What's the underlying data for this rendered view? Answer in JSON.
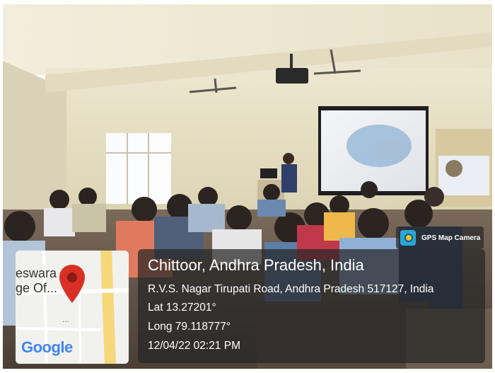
{
  "gps_badge": {
    "label": "GPS Map Camera",
    "icon": "camera-icon"
  },
  "location": {
    "title": "Chittoor, Andhra Pradesh, India",
    "address": "R.V.S. Nagar Tirupati Road, Andhra Pradesh 517127, India",
    "latitude": "Lat 13.27201°",
    "longitude": "Long 79.118777°",
    "datetime": "12/04/22 02:21 PM"
  },
  "map": {
    "label_line_1": "eswara",
    "label_line_2": "ge Of...",
    "dots": "...",
    "provider": "Google",
    "pin_icon": "map-pin-icon",
    "pin_color": "#d93025"
  },
  "photo": {
    "description_colors": {
      "wall": "#e9e3c9",
      "screen": "#eef0f3",
      "banner": "#d8c8a0"
    }
  }
}
